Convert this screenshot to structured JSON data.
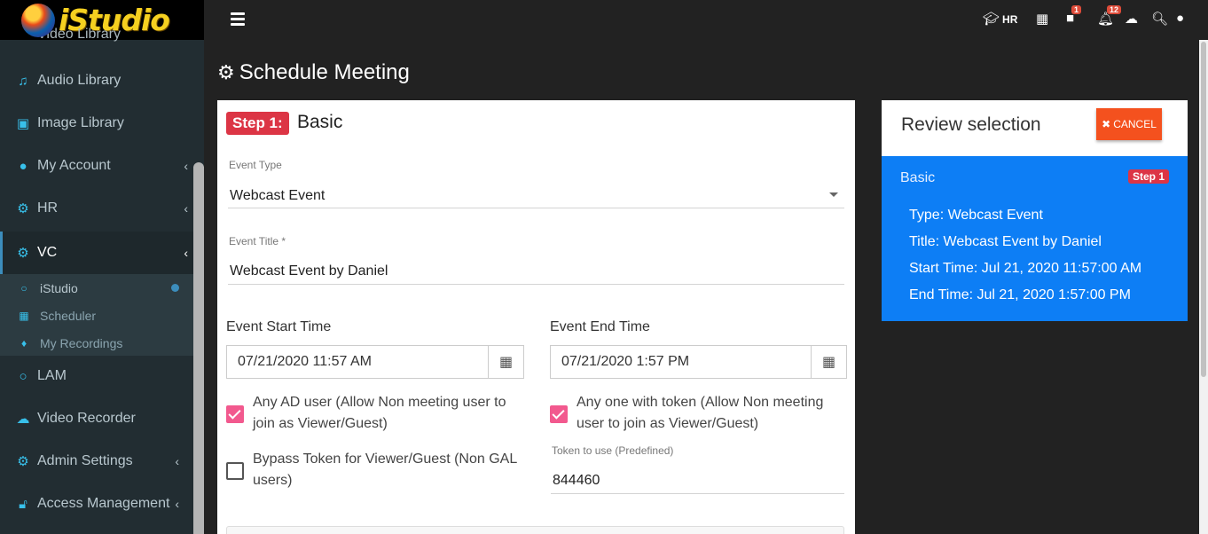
{
  "app": {
    "brand": "iStudio",
    "brand_partial": "Video Library"
  },
  "header": {
    "hr_label": "HR",
    "messages_badge": "1",
    "notifications_badge": "12"
  },
  "sidebar": {
    "items": [
      {
        "label": "Audio Library",
        "icon": "music-icon"
      },
      {
        "label": "Image Library",
        "icon": "image-icon"
      },
      {
        "label": "My Account",
        "icon": "user-icon"
      },
      {
        "label": "HR",
        "icon": "cogs-icon"
      },
      {
        "label": "VC",
        "icon": "cogs-icon"
      },
      {
        "label": "LAM",
        "icon": "circle-icon"
      },
      {
        "label": "Video Recorder",
        "icon": "cloud-upload-icon"
      },
      {
        "label": "Admin Settings",
        "icon": "cogs-icon"
      },
      {
        "label": "Access Management",
        "icon": "lock-icon"
      }
    ],
    "submenu": [
      {
        "label": "iStudio",
        "icon": "circle-icon"
      },
      {
        "label": "Scheduler",
        "icon": "calendar-icon"
      },
      {
        "label": "My Recordings",
        "icon": "microphone-icon"
      }
    ]
  },
  "page": {
    "title": "Schedule Meeting"
  },
  "form": {
    "step_badge": "Step 1:",
    "step_title": "Basic",
    "event_type_label": "Event Type",
    "event_type_value": "Webcast Event",
    "event_title_label": "Event Title *",
    "event_title_value": "Webcast Event by Daniel",
    "start_label": "Event Start Time",
    "start_value": "07/21/2020 11:57 AM",
    "end_label": "Event End Time",
    "end_value": "07/21/2020 1:57 PM",
    "any_ad_user_line1": "Any AD user (Allow Non meeting user to",
    "any_ad_user_line2": "join as Viewer/Guest)",
    "any_token_line1": "Any one with token (Allow Non meeting",
    "any_token_line2": "user to join as Viewer/Guest)",
    "bypass_line1": "Bypass Token for Viewer/Guest (Non GAL",
    "bypass_line2": "users)",
    "token_label": "Token to use (Predefined)",
    "token_value": "844460"
  },
  "review": {
    "title": "Review selection",
    "cancel_label": "CANCEL",
    "section": "Basic",
    "step_badge": "Step 1",
    "type_line": "Type: Webcast Event",
    "title_line": "Title: Webcast Event by Daniel",
    "start_line": "Start Time: Jul 21, 2020 11:57:00 AM",
    "end_line": "End Time: Jul 21, 2020 1:57:00 PM"
  },
  "colors": {
    "accent_blue": "#0d7ef5",
    "danger_red": "#dc3545",
    "cancel_orange": "#f4511e",
    "checkbox_pink": "#f2598e",
    "sidebar_bg": "#222d32"
  }
}
